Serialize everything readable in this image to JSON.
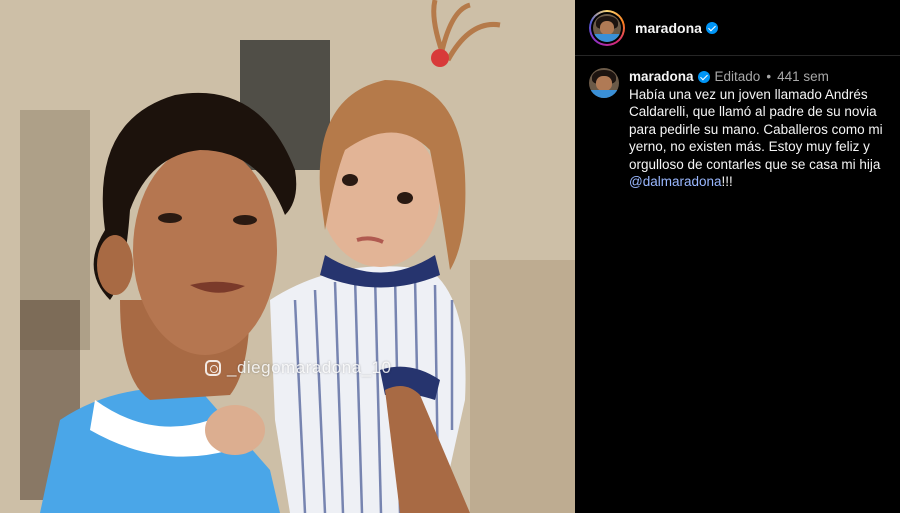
{
  "photo": {
    "watermark_text": "_diegomaradona_10"
  },
  "header": {
    "username": "maradona"
  },
  "post": {
    "username": "maradona",
    "edited_label": "Editado",
    "separator": "•",
    "time_ago": "441 sem",
    "caption_text": "Había una vez un joven llamado Andrés Caldarelli, que llamó al padre de su novia para pedirle su mano. Caballeros como mi yerno, no existen más. Estoy muy feliz y orgulloso de contarles que se casa mi hija ",
    "mention": "@dalmaradona",
    "caption_end": "!!!"
  },
  "colors": {
    "background": "#000000",
    "text": "#f5f5f5",
    "muted": "#a8a8a8",
    "verified": "#0095f6",
    "mention": "#9ab8ff"
  }
}
